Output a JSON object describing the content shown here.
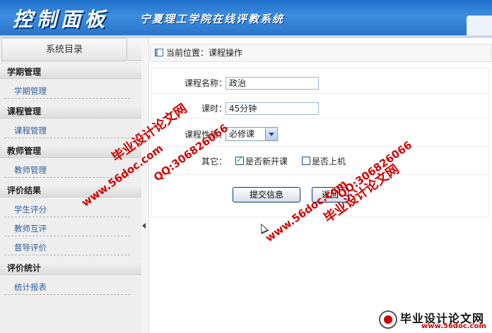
{
  "header": {
    "title": "控制面板",
    "subtitle": "宁夏理工学院在线评教系统"
  },
  "sidebar": {
    "heading": "系统目录",
    "groups": [
      {
        "title": "学期管理",
        "items": [
          "学期管理"
        ]
      },
      {
        "title": "课程管理",
        "items": [
          "课程管理"
        ]
      },
      {
        "title": "教师管理",
        "items": [
          "教师管理"
        ]
      },
      {
        "title": "评价结果",
        "items": [
          "学生评分",
          "教师互评",
          "督导评价"
        ]
      },
      {
        "title": "评价统计",
        "items": [
          "统计报表"
        ]
      }
    ]
  },
  "breadcrumb": {
    "label": "当前位置：课程操作"
  },
  "form": {
    "course_name_label": "课程名称：",
    "course_name_value": "政治",
    "hours_label": "课时：",
    "hours_value": "45分钟",
    "nature_label": "课程性质：",
    "nature_value": "必修课",
    "other_label": "其它：",
    "checkbox_new": {
      "label": "是否新开课",
      "checked": true
    },
    "checkbox_online": {
      "label": "是否上机",
      "checked": false
    },
    "submit_label": "提交信息",
    "back_label": "返回"
  },
  "watermarks": {
    "site": "www.56doc.com",
    "qq": "QQ:306826066",
    "name": "毕业设计论文网",
    "logo_name": "毕业设计论文网",
    "logo_site": "www.56doc.com"
  },
  "colors": {
    "header_blue": "#2a74c9",
    "link_blue": "#2f5fa0",
    "watermark_red": "#d40000"
  }
}
